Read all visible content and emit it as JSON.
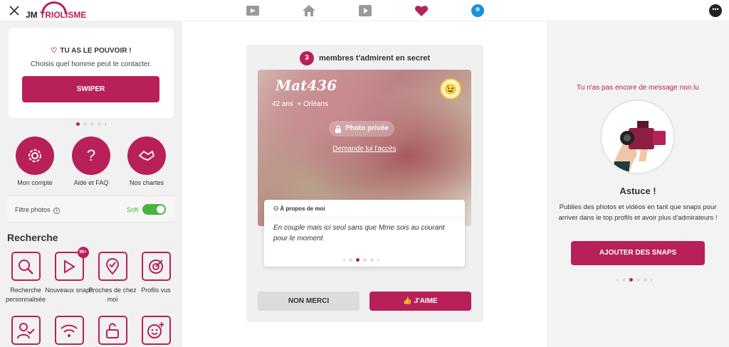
{
  "app": {
    "brand_jm": "JM",
    "brand_name": "TRIOLISME"
  },
  "nav": {
    "icons": [
      "snaps-icon",
      "home-icon",
      "video-icon",
      "heart-icon",
      "avatar-icon",
      "chat-icon"
    ],
    "active": "heart-icon",
    "accent": "#b8205a"
  },
  "left": {
    "power_card": {
      "title": "TU AS LE POUVOIR !",
      "subtitle": "Choisis quel homme peut te contacter.",
      "button": "SWIPER",
      "carousel_next": "›"
    },
    "quick_links": [
      {
        "label": "Mon compte",
        "icon": "gear-icon"
      },
      {
        "label": "Aide et FAQ",
        "icon": "question-icon"
      },
      {
        "label": "Nos chartes",
        "icon": "handshake-icon"
      }
    ],
    "filter": {
      "label": "Filtre photos",
      "info": "i",
      "value": "Soft",
      "enabled": true
    },
    "search_title": "Recherche",
    "search_items": [
      {
        "label": "Recherche personnalisée",
        "icon": "magnifier-icon"
      },
      {
        "label": "Nouveaux snaps",
        "icon": "play-icon",
        "badge": "99+"
      },
      {
        "label": "Proches de chez moi",
        "icon": "location-icon"
      },
      {
        "label": "Profils vus",
        "icon": "target-icon"
      },
      {
        "label": "",
        "icon": "user-check-icon"
      },
      {
        "label": "",
        "icon": "wifi-icon"
      },
      {
        "label": "",
        "icon": "unlock-icon"
      },
      {
        "label": "",
        "icon": "smiley-plus-icon"
      }
    ]
  },
  "center": {
    "count": "3",
    "count_text": "membres t'admirent en secret",
    "profile": {
      "username": "Mat436",
      "age": "42 ans",
      "city": "Orléans",
      "private_label": "Photo privée",
      "request_link": "Demande lui l'accès",
      "wink_icon": "wink-emoji-icon"
    },
    "about": {
      "title": "À propos de moi",
      "text": "En couple mais ici seul sans que Mme sois au courant pour le moment"
    },
    "carousel_prev": "‹",
    "carousel_next": "›",
    "decline": "NON MERCI",
    "like": "J'AIME"
  },
  "right": {
    "no_message": "Tu n'as pas encore de message non lu",
    "tip_title": "Astuce !",
    "tip_text": "Publies des photos et vidéos en tant que snaps pour arriver dans le top profils et avoir plus d'admirateurs !",
    "button": "AJOUTER DES SNAPS",
    "carousel_prev": "‹",
    "carousel_next": "›"
  }
}
